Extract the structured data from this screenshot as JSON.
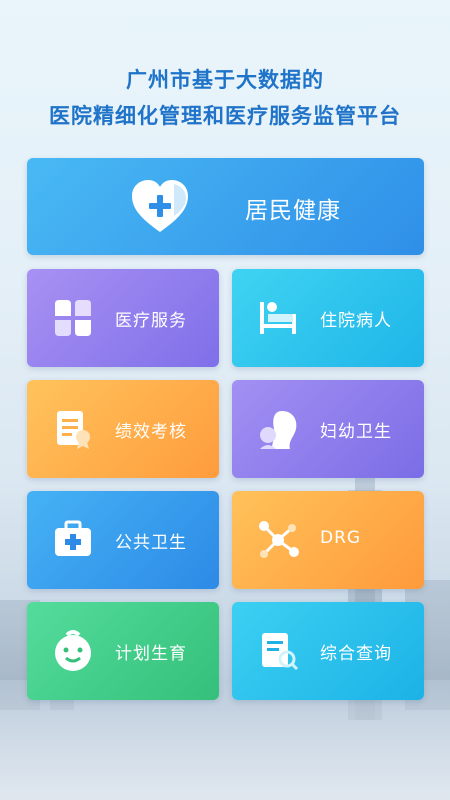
{
  "header": {
    "line1": "广州市基于大数据的",
    "line2": "医院精细化管理和医疗服务监管平台"
  },
  "tiles": {
    "resident_health": {
      "label": "居民健康",
      "icon": "heart-plus-icon"
    },
    "medical_service": {
      "label": "医疗服务",
      "icon": "clover-icon"
    },
    "inpatients": {
      "label": "住院病人",
      "icon": "hospital-bed-icon"
    },
    "performance": {
      "label": "绩效考核",
      "icon": "document-award-icon"
    },
    "maternal_child": {
      "label": "妇幼卫生",
      "icon": "mother-child-icon"
    },
    "public_health": {
      "label": "公共卫生",
      "icon": "medical-kit-icon"
    },
    "drg": {
      "label": "DRG",
      "icon": "molecule-icon"
    },
    "family_planning": {
      "label": "计划生育",
      "icon": "baby-face-icon"
    },
    "comprehensive_query": {
      "label": "综合查询",
      "icon": "document-search-icon"
    }
  },
  "colors": {
    "title": "#1f73c8",
    "resident_health": "#3aa4ee",
    "purple": "#8f7ef0",
    "cyan": "#2cc3ee",
    "orange": "#ffad4a",
    "green": "#42cd88"
  }
}
